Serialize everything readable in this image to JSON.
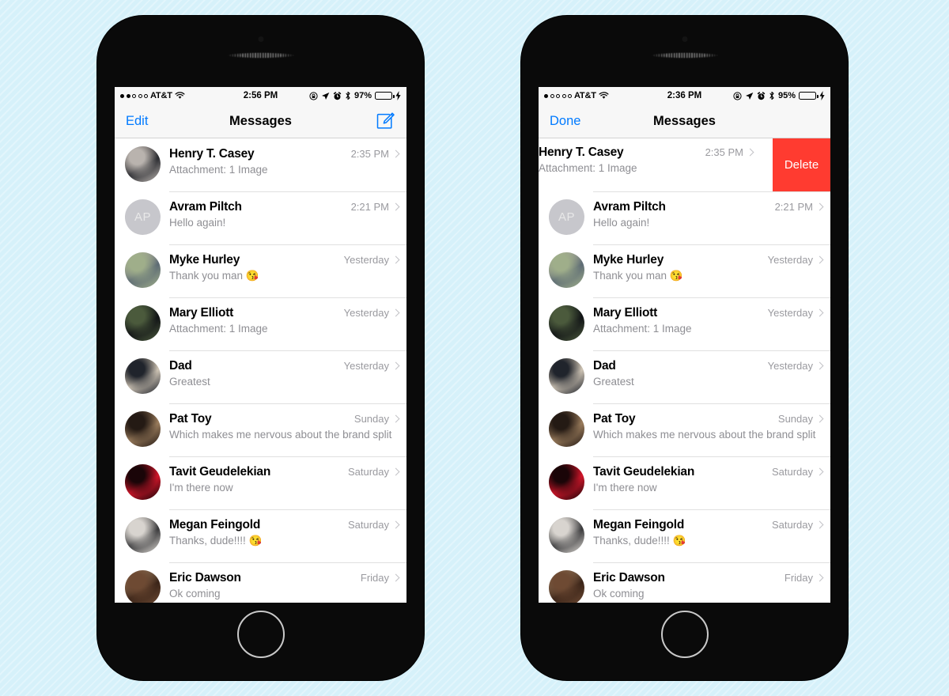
{
  "background": {
    "color": "#d6f1fa"
  },
  "phones": [
    {
      "id": "left",
      "state_label": "default",
      "status_bar": {
        "signal_filled": 2,
        "signal_total": 5,
        "carrier": "AT&T",
        "wifi_icon": "wifi-icon",
        "time": "2:56 PM",
        "rotation_lock_icon": "rotation-lock-icon",
        "location_icon": "location-arrow-icon",
        "alarm_icon": "alarm-clock-icon",
        "bluetooth_icon": "bluetooth-icon",
        "battery_percent": "97%",
        "battery_level": 97,
        "charging_icon": "lightning-bolt-icon"
      },
      "nav": {
        "left_action": "Edit",
        "title": "Messages",
        "right_icon": "compose-icon"
      },
      "conversations": [
        {
          "name": "Henry T. Casey",
          "preview": "Attachment: 1 Image",
          "time": "2:35 PM",
          "avatar_type": "photo",
          "avatar_colors": [
            "#b9b3ae",
            "#2a2b30",
            "#6d6560"
          ],
          "initials": "",
          "swiped": false
        },
        {
          "name": "Avram Piltch",
          "preview": "Hello again!",
          "time": "2:21 PM",
          "avatar_type": "initials",
          "avatar_colors": [
            "#c7c7cc",
            "#c7c7cc",
            "#c7c7cc"
          ],
          "initials": "AP",
          "swiped": false
        },
        {
          "name": "Myke Hurley",
          "preview": "Thank you man ",
          "emoji": "😘",
          "time": "Yesterday",
          "avatar_type": "photo",
          "avatar_colors": [
            "#9fae8a",
            "#5d6b74",
            "#c6bda6"
          ],
          "initials": "",
          "swiped": false
        },
        {
          "name": "Mary Elliott",
          "preview": "Attachment: 1 Image",
          "time": "Yesterday",
          "avatar_type": "photo",
          "avatar_colors": [
            "#4b5a3c",
            "#101215",
            "#2d3a2a"
          ],
          "initials": "",
          "swiped": false
        },
        {
          "name": "Dad",
          "preview": "Greatest",
          "time": "Yesterday",
          "avatar_type": "photo",
          "avatar_colors": [
            "#20242c",
            "#cdc3b4",
            "#7d7466"
          ],
          "initials": "",
          "swiped": false
        },
        {
          "name": "Pat Toy",
          "preview": "Which makes me nervous about the brand split",
          "time": "Sunday",
          "avatar_type": "photo",
          "avatar_colors": [
            "#241a14",
            "#9a7c5c",
            "#4d3a2a"
          ],
          "initials": "",
          "swiped": false
        },
        {
          "name": "Tavit Geudelekian",
          "preview": "I'm there now",
          "time": "Saturday",
          "avatar_type": "photo",
          "avatar_colors": [
            "#1a0508",
            "#d0162a",
            "#7a0a16"
          ],
          "initials": "",
          "swiped": false
        },
        {
          "name": "Megan Feingold",
          "preview": "Thanks, dude!!!! ",
          "emoji": "😘",
          "time": "Saturday",
          "avatar_type": "photo",
          "avatar_colors": [
            "#d8d4cf",
            "#3a3a3c",
            "#8d8a86"
          ],
          "initials": "",
          "swiped": false
        },
        {
          "name": "Eric Dawson",
          "preview": "Ok coming",
          "time": "Friday",
          "avatar_type": "photo",
          "avatar_colors": [
            "#6e4a33",
            "#3a2418",
            "#b9a07c"
          ],
          "initials": "",
          "swiped": false
        }
      ]
    },
    {
      "id": "right",
      "state_label": "edit-swipe",
      "status_bar": {
        "signal_filled": 1,
        "signal_total": 5,
        "carrier": "AT&T",
        "wifi_icon": "wifi-icon",
        "time": "2:36 PM",
        "rotation_lock_icon": "rotation-lock-icon",
        "location_icon": "location-arrow-icon",
        "alarm_icon": "alarm-clock-icon",
        "bluetooth_icon": "bluetooth-icon",
        "battery_percent": "95%",
        "battery_level": 95,
        "charging_icon": "lightning-bolt-icon"
      },
      "nav": {
        "left_action": "Done",
        "title": "Messages",
        "right_icon": ""
      },
      "delete_action": {
        "label": "Delete",
        "color": "#ff3b30"
      },
      "conversations": [
        {
          "name": "Henry T. Casey",
          "preview": "Attachment: 1 Image",
          "time": "2:35 PM",
          "avatar_type": "photo",
          "avatar_colors": [
            "#b9b3ae",
            "#2a2b30",
            "#6d6560"
          ],
          "initials": "",
          "swiped": true
        },
        {
          "name": "Avram Piltch",
          "preview": "Hello again!",
          "time": "2:21 PM",
          "avatar_type": "initials",
          "avatar_colors": [
            "#c7c7cc",
            "#c7c7cc",
            "#c7c7cc"
          ],
          "initials": "AP",
          "swiped": false
        },
        {
          "name": "Myke Hurley",
          "preview": "Thank you man ",
          "emoji": "😘",
          "time": "Yesterday",
          "avatar_type": "photo",
          "avatar_colors": [
            "#9fae8a",
            "#5d6b74",
            "#c6bda6"
          ],
          "initials": "",
          "swiped": false
        },
        {
          "name": "Mary Elliott",
          "preview": "Attachment: 1 Image",
          "time": "Yesterday",
          "avatar_type": "photo",
          "avatar_colors": [
            "#4b5a3c",
            "#101215",
            "#2d3a2a"
          ],
          "initials": "",
          "swiped": false
        },
        {
          "name": "Dad",
          "preview": "Greatest",
          "time": "Yesterday",
          "avatar_type": "photo",
          "avatar_colors": [
            "#20242c",
            "#cdc3b4",
            "#7d7466"
          ],
          "initials": "",
          "swiped": false
        },
        {
          "name": "Pat Toy",
          "preview": "Which makes me nervous about the brand split",
          "time": "Sunday",
          "avatar_type": "photo",
          "avatar_colors": [
            "#241a14",
            "#9a7c5c",
            "#4d3a2a"
          ],
          "initials": "",
          "swiped": false
        },
        {
          "name": "Tavit Geudelekian",
          "preview": "I'm there now",
          "time": "Saturday",
          "avatar_type": "photo",
          "avatar_colors": [
            "#1a0508",
            "#d0162a",
            "#7a0a16"
          ],
          "initials": "",
          "swiped": false
        },
        {
          "name": "Megan Feingold",
          "preview": "Thanks, dude!!!! ",
          "emoji": "😘",
          "time": "Saturday",
          "avatar_type": "photo",
          "avatar_colors": [
            "#d8d4cf",
            "#3a3a3c",
            "#8d8a86"
          ],
          "initials": "",
          "swiped": false
        },
        {
          "name": "Eric Dawson",
          "preview": "Ok coming",
          "time": "Friday",
          "avatar_type": "photo",
          "avatar_colors": [
            "#6e4a33",
            "#3a2418",
            "#b9a07c"
          ],
          "initials": "",
          "swiped": false
        }
      ]
    }
  ],
  "theme": {
    "tint_blue": "#007aff",
    "delete_red": "#ff3b30",
    "battery_green": "#4cd964",
    "secondary_text": "#8e8e93"
  }
}
